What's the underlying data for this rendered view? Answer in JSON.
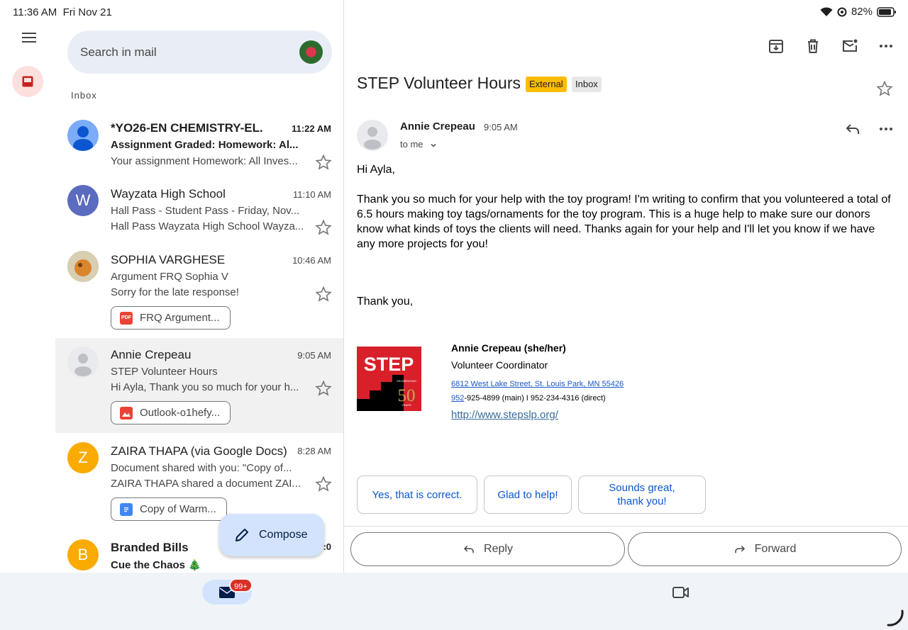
{
  "status": {
    "time": "11:36 AM",
    "date": "Fri Nov 21",
    "battery": "82%"
  },
  "search": {
    "placeholder": "Search in mail"
  },
  "list_label": "Inbox",
  "emails": [
    {
      "sender": "*YO26-EN CHEMISTRY-EL.",
      "time": "11:22 AM",
      "subject": "Assignment Graded: Homework: Al...",
      "snippet": "Your assignment Homework: All Inves...",
      "unread": true,
      "avatar": "person",
      "avatar_color": "#7cacf8"
    },
    {
      "sender": "Wayzata High School",
      "time": "11:10 AM",
      "subject": "Hall Pass - Student Pass - Friday, Nov...",
      "snippet": "Hall Pass Wayzata High School Wayza...",
      "unread": false,
      "avatar_letter": "W",
      "avatar_color": "#5b6bc0"
    },
    {
      "sender": "SOPHIA VARGHESE",
      "time": "10:46 AM",
      "subject": "Argument FRQ Sophia V",
      "snippet": "Sorry for the late response!",
      "unread": false,
      "attachment": "FRQ Argument...",
      "attachment_icon": "pdf-icon"
    },
    {
      "sender": "Annie Crepeau",
      "time": "9:05 AM",
      "subject": "STEP Volunteer Hours",
      "snippet": "Hi Ayla, Thank you so much for your h...",
      "unread": false,
      "attachment": "Outlook-o1hefy...",
      "attachment_icon": "image-icon",
      "selected": true
    },
    {
      "sender": "ZAIRA THAPA (via Google Docs)",
      "time": "8:28 AM",
      "subject": "Document shared with you: \"Copy of...",
      "snippet": "ZAIRA THAPA shared a document ZAI...",
      "unread": false,
      "attachment": "Copy of Warm...",
      "attachment_icon": "docs-icon",
      "avatar_letter": "Z",
      "avatar_color": "#f9ab00"
    },
    {
      "sender": "Branded Bills",
      "time": ":0",
      "subject": "Cue the Chaos 🎄",
      "unread": true,
      "avatar_letter": "B",
      "avatar_color": "#f9ab00"
    }
  ],
  "pdf_tag": "PDF",
  "compose_label": "Compose",
  "message": {
    "title": "STEP Volunteer Hours",
    "labels": [
      "External",
      "Inbox"
    ],
    "from": "Annie Crepeau",
    "time": "9:05 AM",
    "to": "to me",
    "greeting": "Hi Ayla,",
    "body": "Thank you so much for your help with the toy program! I'm writing to confirm that you volunteered a total of 6.5 hours making toy tags/ornaments for the toy program. This is a huge help to make sure our donors know what kinds of toys the clients will need. Thanks again for your help and I'll let you know if we have any more projects for you!",
    "closing": "Thank you,",
    "signature": {
      "logo_text": "STEP",
      "logo_caption_top": "CELEBRATING",
      "logo_number": "50",
      "logo_caption_bottom": "YEARS",
      "name": "Annie Crepeau (she/her)",
      "role": "Volunteer Coordinator",
      "address": "6812 West Lake Street, St. Louis Park, MN 55426",
      "phone_link": "952",
      "phone_rest": "-925-4899 (main) I 952-234-4316 (direct)",
      "website": "http://www.stepslp.org/"
    }
  },
  "smart_replies": [
    "Yes, that is correct.",
    "Glad to help!",
    "Sounds great, thank you!"
  ],
  "actions": {
    "reply": "Reply",
    "forward": "Forward"
  },
  "nav": {
    "mail_badge": "99+"
  }
}
